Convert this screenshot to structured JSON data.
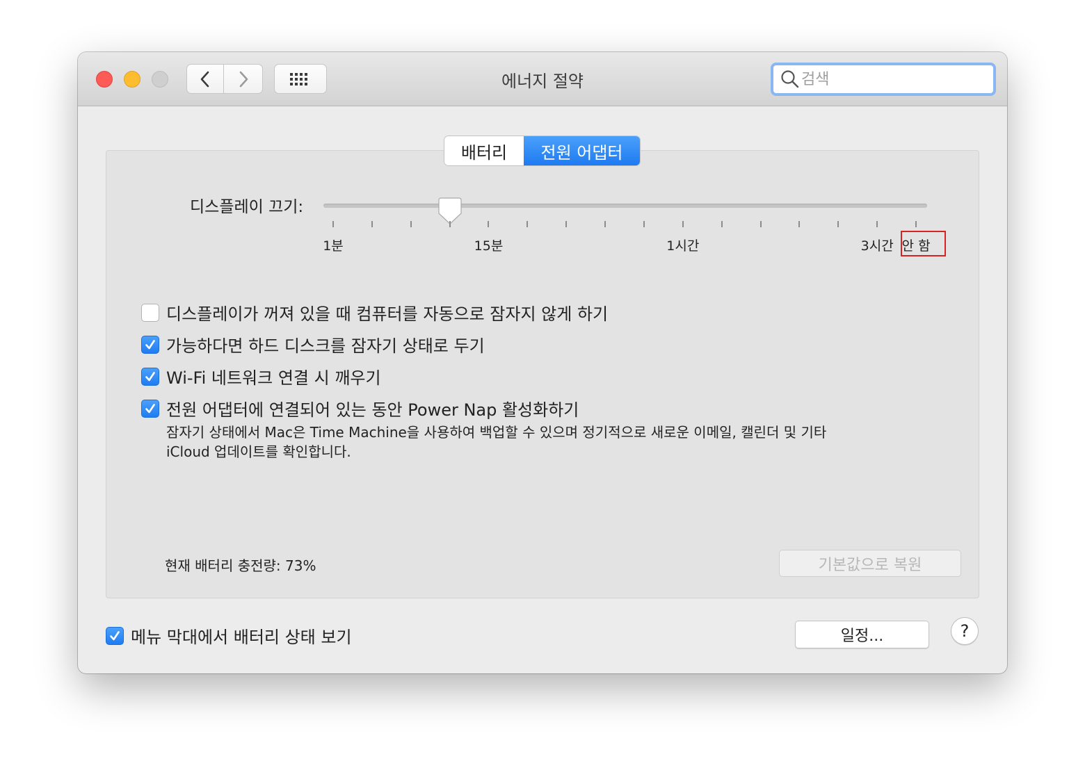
{
  "window": {
    "title": "에너지 절약",
    "traffic_lights": {
      "close": "#fd5b56",
      "minimize": "#febc2f",
      "zoom": "#cfcfcf"
    },
    "nav": {
      "back_icon": "chevron-left-icon",
      "forward_icon": "chevron-right-icon",
      "grid_icon": "show-all-grid-icon"
    },
    "search": {
      "placeholder": "검색",
      "value": "",
      "icon": "search-icon"
    }
  },
  "tabs": [
    {
      "label": "배터리",
      "selected": false
    },
    {
      "label": "전원 어댑터",
      "selected": true
    }
  ],
  "accent_color": "#1e7bf1",
  "display_sleep": {
    "label": "디스플레이 끄기:",
    "tick_count": 16,
    "selected_tick_index": 3,
    "scale_labels": [
      {
        "text": "1분",
        "tick_index": 0
      },
      {
        "text": "15분",
        "tick_index": 4
      },
      {
        "text": "1시간",
        "tick_index": 9
      },
      {
        "text": "3시간",
        "tick_index": 14
      },
      {
        "text": "안 함",
        "tick_index": 15
      }
    ],
    "highlighted_label": "안 함",
    "highlight_color": "#d82222"
  },
  "options": [
    {
      "label": "디스플레이가 꺼져 있을 때 컴퓨터를 자동으로 잠자지 않게 하기",
      "checked": false
    },
    {
      "label": "가능하다면 하드 디스크를 잠자기 상태로 두기",
      "checked": true
    },
    {
      "label": "Wi-Fi 네트워크 연결 시 깨우기",
      "checked": true
    },
    {
      "label": "전원 어댑터에 연결되어 있는 동안 Power Nap 활성화하기",
      "checked": true
    }
  ],
  "power_nap_description": [
    "잠자기 상태에서 Mac은 Time Machine을 사용하여 백업할 수 있으며 정기적으로 새로운 이메일, 캘린더 및 기타",
    "iCloud 업데이트를 확인합니다."
  ],
  "battery_charge_label": "현재 배터리 충전량: 73%",
  "restore_defaults_label": "기본값으로 복원",
  "restore_defaults_enabled": false,
  "show_in_menu_bar": {
    "label": "메뉴 막대에서 배터리 상태 보기",
    "checked": true
  },
  "schedule_label": "일정...",
  "help_label": "?"
}
